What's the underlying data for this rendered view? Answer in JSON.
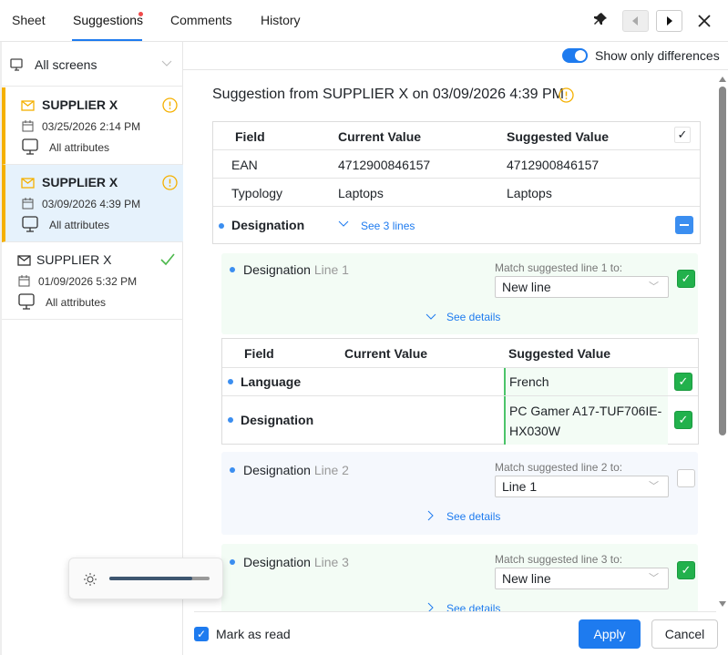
{
  "tabs": [
    {
      "label": "Sheet"
    },
    {
      "label": "Suggestions",
      "active": true,
      "has_notification": true
    },
    {
      "label": "Comments"
    },
    {
      "label": "History"
    }
  ],
  "toolbar": {
    "pin": "pin-icon",
    "prev": "previous-icon",
    "next": "next-icon",
    "close": "close-icon"
  },
  "sidebar": {
    "filter": {
      "value": "All screens"
    },
    "items": [
      {
        "supplier": "SUPPLIER X",
        "date": "03/25/2026 2:14 PM",
        "scope": "All attributes",
        "status": "pending"
      },
      {
        "supplier": "SUPPLIER X",
        "date": "03/09/2026 4:39 PM",
        "scope": "All attributes",
        "status": "pending",
        "selected": true
      },
      {
        "supplier": "SUPPLIER X",
        "date": "01/09/2026 5:32 PM",
        "scope": "All attributes",
        "status": "done"
      }
    ]
  },
  "toggle": {
    "label": "Show only differences",
    "on": true
  },
  "main": {
    "title": "Suggestion from SUPPLIER X on 03/09/2026 4:39 PM",
    "table": {
      "headers": [
        "Field",
        "Current Value",
        "Suggested Value"
      ],
      "rows": [
        {
          "field": "EAN",
          "current": "4712900846157",
          "suggested": "4712900846157"
        },
        {
          "field": "Typology",
          "current": "Laptops",
          "suggested": "Laptops"
        }
      ],
      "designation": {
        "field": "Designation",
        "link": "See 3 lines"
      }
    },
    "lines": [
      {
        "name": "Designation",
        "line": "Line 1",
        "match_label": "Match suggested line 1 to:",
        "match_value": "New line",
        "checked": true,
        "details": "See details",
        "sub_table": {
          "headers": [
            "Field",
            "Current Value",
            "Suggested Value"
          ],
          "rows": [
            {
              "field": "Language",
              "current": "",
              "suggested": "French"
            },
            {
              "field": "Designation",
              "current": "",
              "suggested": "PC Gamer A17-TUF706IE-HX030W"
            }
          ]
        }
      },
      {
        "name": "Designation",
        "line": "Line 2",
        "match_label": "Match suggested line 2 to:",
        "match_value": "Line 1",
        "checked": false,
        "details": "See details"
      },
      {
        "name": "Designation",
        "line": "Line 3",
        "match_label": "Match suggested line 3 to:",
        "match_value": "New line",
        "checked": true,
        "details": "See details"
      }
    ]
  },
  "footer": {
    "mark_read": "Mark as read",
    "mark_read_checked": true,
    "apply": "Apply",
    "cancel": "Cancel"
  },
  "brightness": {
    "level": 0.83
  },
  "colors": {
    "accent": "#1e7bef",
    "warning": "#f5b000",
    "success": "#22b14c"
  }
}
